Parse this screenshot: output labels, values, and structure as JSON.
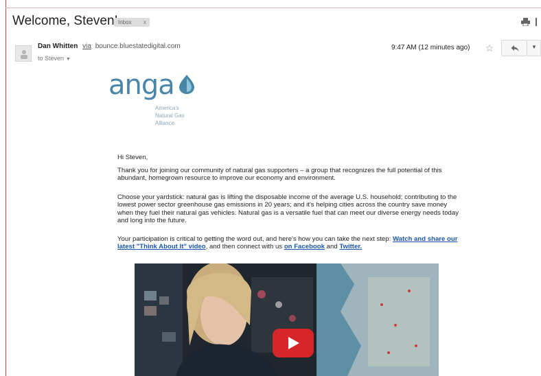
{
  "email": {
    "subject": "Welcome, Steven!",
    "label": "Inbox",
    "label_close": "x",
    "sender_name": "Dan Whitten",
    "via": "via",
    "sender_domain": "bounce.bluestatedigital.com",
    "recipient": "to Steven",
    "timestamp": "9:47 AM (12 minutes ago)"
  },
  "logo": {
    "word": "anga",
    "tagline": [
      "America's",
      "Natural Gas",
      "Alliance"
    ],
    "color": "#4a86a8"
  },
  "message": {
    "greeting": "Hi Steven,",
    "para1": "Thank you for joining our community of natural gas supporters – a group that recognizes the full potential of this abundant, homegrown resource to improve our economy and environment.",
    "para2": "Choose your yardstick: natural gas is lifting the disposable income of the average U.S. household; contributing to the lowest power sector greenhouse gas emissions in 20 years; and it's helping cities across the country save money when they fuel their natural gas vehicles. Natural gas is a versatile fuel that can meet our diverse energy needs today and long into the future.",
    "para3_intro": "Your participation is critical to getting the word out, and here's how you can take the next step:",
    "link_video": "Watch and share our latest \"Think About It\" video",
    "para3_mid": ", and then connect with us ",
    "link_facebook": "on Facebook",
    "para3_and": " and ",
    "link_twitter": "Twitter."
  },
  "icons": {
    "print": "print-icon",
    "more": "more-vertical-icon",
    "star": "star-icon",
    "reply": "reply-icon",
    "menu": "chevron-down-icon",
    "play": "play-icon"
  }
}
